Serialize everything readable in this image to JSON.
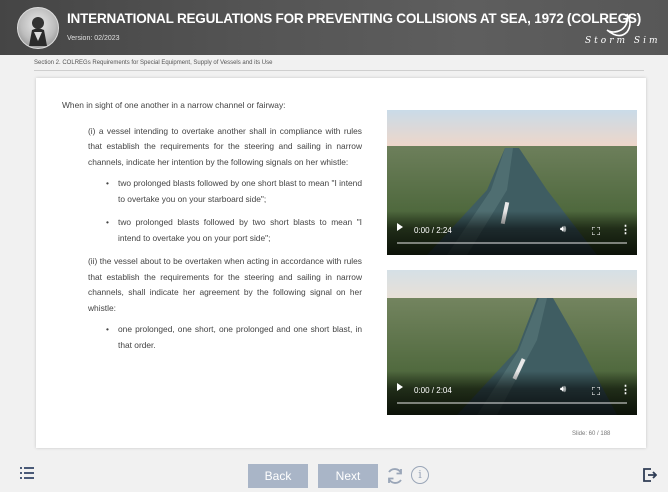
{
  "header": {
    "title": "INTERNATIONAL REGULATIONS FOR PREVENTING COLLISIONS AT SEA, 1972 (COLREGS)",
    "version": "Version: 02/2023",
    "brand": "Storm Sim"
  },
  "section": "Section 2. COLREGs Requirements for Special Equipment, Supply of Vessels and its Use",
  "content": {
    "intro": "When in sight of one another in a narrow channel or fairway:",
    "para1": "(i) a vessel intending to overtake another shall in compliance with rules that establish the requirements for the steering and sailing in narrow channels, indicate her intention by the following signals on her whistle:",
    "bullet1": "two prolonged blasts followed by one short blast to mean \"I intend to overtake you on your starboard side\";",
    "bullet2": "two prolonged blasts followed by two short blasts to mean \"I intend to overtake you on your port side\";",
    "para2": "(ii) the vessel about to be overtaken when acting in accordance with rules that establish the requirements for the steering and sailing in narrow channels, shall indicate her agreement by the following signal on her whistle:",
    "bullet3": "one prolonged, one short, one prolonged and one short blast, in that order."
  },
  "videos": [
    {
      "time": "0:00 / 2:24",
      "progress": 0
    },
    {
      "time": "0:00 / 2:04",
      "progress": 0
    }
  ],
  "slide": "Slide: 60 / 188",
  "nav": {
    "back": "Back",
    "next": "Next"
  },
  "colors": {
    "header_bg": "#4a4a4a",
    "button_bg": "#a9b5c7",
    "icon": "#9aa6b8",
    "text": "#444444"
  },
  "icons": [
    "menu-icon",
    "refresh-icon",
    "info-icon",
    "exit-icon",
    "play-icon",
    "volume-icon",
    "fullscreen-icon",
    "more-options-icon"
  ]
}
